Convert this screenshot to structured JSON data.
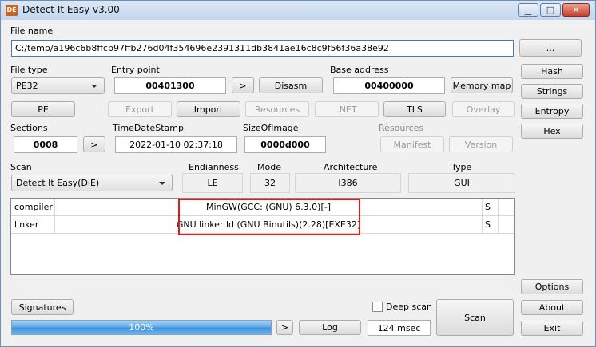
{
  "window": {
    "title": "Detect It Easy v3.00",
    "icon_text": "DE",
    "icon_name": "die-app-icon",
    "controls": {
      "minimize": "▁",
      "maximize": "□",
      "close": "✕"
    }
  },
  "file": {
    "label": "File name",
    "path": "C:/temp/a196c6b8ffcb97ffb276d04f354696e2391311db3841ae16c8c9f56f36a38e92",
    "browse": "..."
  },
  "side": {
    "hash": "Hash",
    "strings": "Strings",
    "entropy": "Entropy",
    "hex": "Hex",
    "options": "Options",
    "about": "About",
    "exit": "Exit"
  },
  "filetype": {
    "label": "File type",
    "value": "PE32"
  },
  "entry": {
    "label": "Entry point",
    "value": "00401300",
    "next": ">",
    "disasm": "Disasm"
  },
  "base": {
    "label": "Base address",
    "value": "00400000",
    "memmap": "Memory map"
  },
  "tabs": {
    "pe": "PE",
    "export": "Export",
    "import": "Import",
    "resources": "Resources",
    "net": ".NET",
    "tls": "TLS",
    "overlay": "Overlay"
  },
  "sections": {
    "label": "Sections",
    "value": "0008",
    "next": ">"
  },
  "timestamp": {
    "label": "TimeDateStamp",
    "value": "2022-01-10 02:37:18"
  },
  "sizeofimage": {
    "label": "SizeOfImage",
    "value": "0000d000"
  },
  "resgroup": {
    "label": "Resources",
    "manifest": "Manifest",
    "version": "Version"
  },
  "scan": {
    "label": "Scan",
    "engine": "Detect It Easy(DiE)"
  },
  "info": {
    "endianness_label": "Endianness",
    "endianness": "LE",
    "mode_label": "Mode",
    "mode": "32",
    "arch_label": "Architecture",
    "arch": "I386",
    "type_label": "Type",
    "type": "GUI"
  },
  "results": [
    {
      "type": "compiler",
      "name": "MinGW(GCC: (GNU) 6.3.0)[-]",
      "flag": "S"
    },
    {
      "type": "linker",
      "name": "GNU linker ld (GNU Binutils)(2.28)[EXE32]",
      "flag": "S"
    }
  ],
  "bottom": {
    "signatures": "Signatures",
    "deepscan": "Deep scan",
    "scan_button": "Scan",
    "progress": "100%",
    "progress_fraction": 1.0,
    "next": ">",
    "log": "Log",
    "time": "124 msec"
  },
  "colors": {
    "highlight": "#d81e1e",
    "progress": "#3d90d8",
    "titlebar": "#c3d6ee"
  }
}
